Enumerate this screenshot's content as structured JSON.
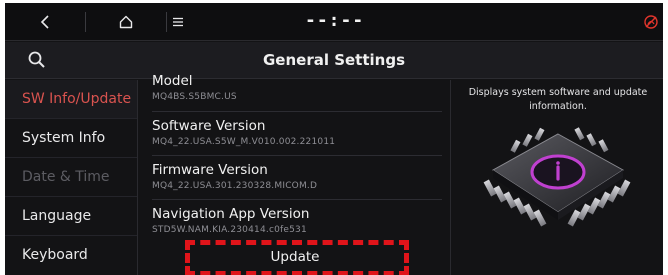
{
  "status_bar": {
    "back_icon": "back-chevron-icon",
    "home_icon": "home-icon",
    "menu_icon": "hamburger-menu-icon",
    "clock": "--:--",
    "status_icon": "no-network-icon",
    "status_color": "#e0352c"
  },
  "header": {
    "title": "General Settings",
    "search_icon": "search-icon"
  },
  "sidebar": {
    "items": [
      {
        "label": "SW Info/Update",
        "state": "active"
      },
      {
        "label": "System Info",
        "state": "normal"
      },
      {
        "label": "Date & Time",
        "state": "disabled"
      },
      {
        "label": "Language",
        "state": "normal"
      },
      {
        "label": "Keyboard",
        "state": "normal"
      }
    ]
  },
  "info_list": [
    {
      "title": "Model",
      "value": "MQ4BS.S5BMC.US"
    },
    {
      "title": "Software Version",
      "value": "MQ4_22.USA.S5W_M.V010.002.221011"
    },
    {
      "title": "Firmware Version",
      "value": "MQ4_22.USA.301.230328.MICOM.D"
    },
    {
      "title": "Navigation App Version",
      "value": "STD5W.NAM.KIA.230414.c0fe531"
    }
  ],
  "actions": {
    "update_label": "Update"
  },
  "panel": {
    "description": "Displays system software and update information.",
    "image": "chip-info-icon",
    "accent_color": "#c040d0"
  },
  "annotation": {
    "highlight_color": "#e0141a"
  }
}
